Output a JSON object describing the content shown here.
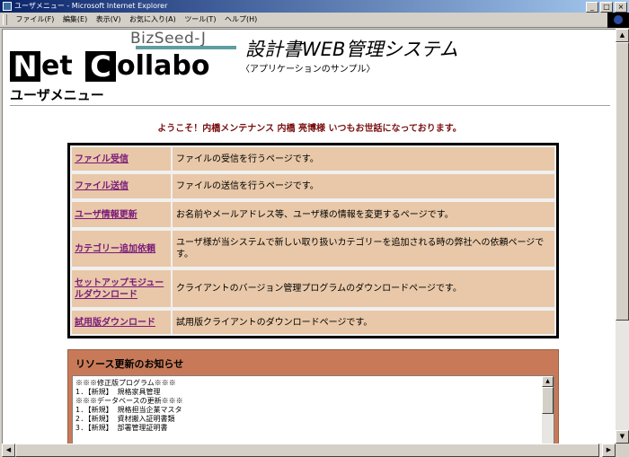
{
  "window": {
    "title": "ユーザメニュー - Microsoft Internet Explorer"
  },
  "menubar": {
    "items": [
      "ファイル(F)",
      "編集(E)",
      "表示(V)",
      "お気に入り(A)",
      "ツール(T)",
      "ヘルプ(H)"
    ]
  },
  "logo": {
    "n": "N",
    "et": "et",
    "c": "C",
    "ollabo": "ollabo",
    "bizseed": "BizSeed-J"
  },
  "header": {
    "system_title": "設計書WEB管理システム",
    "system_desc": "〈アプリケーションのサンプル〉",
    "page_title": "ユーザメニュー"
  },
  "welcome": "ようこそ！内橋メンテナンス 内橋 亮博様 いつもお世話になっております。",
  "menu_items": [
    {
      "label": "ファイル受信",
      "desc": "ファイルの受信を行うページです。"
    },
    {
      "label": "ファイル送信",
      "desc": "ファイルの送信を行うページです。"
    },
    {
      "label": "ユーザ情報更新",
      "desc": "お名前やメールアドレス等、ユーザ様の情報を変更するページです。"
    },
    {
      "label": "カテゴリー追加依頼",
      "desc": "ユーザ様が当システムで新しい取り扱いカテゴリーを追加される時の弊社への依頼ページです。"
    },
    {
      "label": "セットアップモジュールダウンロード",
      "desc": "クライアントのバージョン管理プログラムのダウンロードページです。"
    },
    {
      "label": "試用版ダウンロード",
      "desc": "試用版クライアントのダウンロードページです。"
    }
  ],
  "news": {
    "title": "リソース更新のお知らせ",
    "lines": [
      "※※※修正版プログラム※※※",
      "1.【新規】 規格家具管理",
      "",
      "",
      "※※※データベースの更新※※※",
      "1.【新規】 規格担当企業マスタ",
      "2.【新規】 資材搬入証明書類",
      "3.【新規】 部署管理証明書"
    ]
  },
  "colors": {
    "titlebar": "#0a246a",
    "cell_bg": "#e8c8a8",
    "link": "#7a1a7a",
    "news_bg": "#c87a58",
    "welcome": "#7a1010"
  }
}
